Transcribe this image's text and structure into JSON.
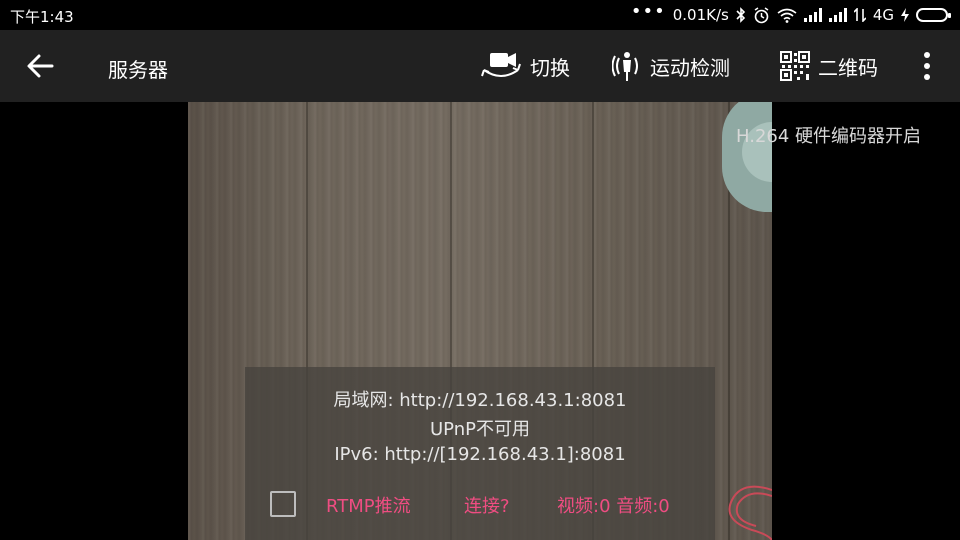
{
  "status_bar": {
    "time": "下午1:43",
    "dots": "•••",
    "net_speed": "0.01K/s",
    "network_label": "4G",
    "icons": [
      "bluetooth-icon",
      "alarm-icon",
      "wifi-icon",
      "signal-icon",
      "signal-icon",
      "data-arrows-icon",
      "charging-icon",
      "battery-icon"
    ]
  },
  "toolbar": {
    "back_icon": "arrow-left-icon",
    "title": "服务器",
    "switch_label": "切换",
    "switch_icon": "camera-switch-icon",
    "motion_label": "运动检测",
    "motion_icon": "motion-detect-icon",
    "qr_label": "二维码",
    "qr_icon": "qr-code-icon",
    "menu_icon": "more-vertical-icon"
  },
  "preview": {
    "encoder_status": "H.264 硬件编码器开启",
    "lan_url": "局域网: http://192.168.43.1:8081",
    "upnp_status": "UPnP不可用",
    "ipv6_url": "IPv6: http://[192.168.43.1]:8081",
    "rtmp_label": "RTMP推流",
    "rtmp_checked": false,
    "connect_label": "连接?",
    "av_count": "视频:0 音频:0"
  },
  "colors": {
    "toolbar_bg": "#212121",
    "accent_pink": "#ef4d82",
    "overlay_bg": "#46423e"
  }
}
